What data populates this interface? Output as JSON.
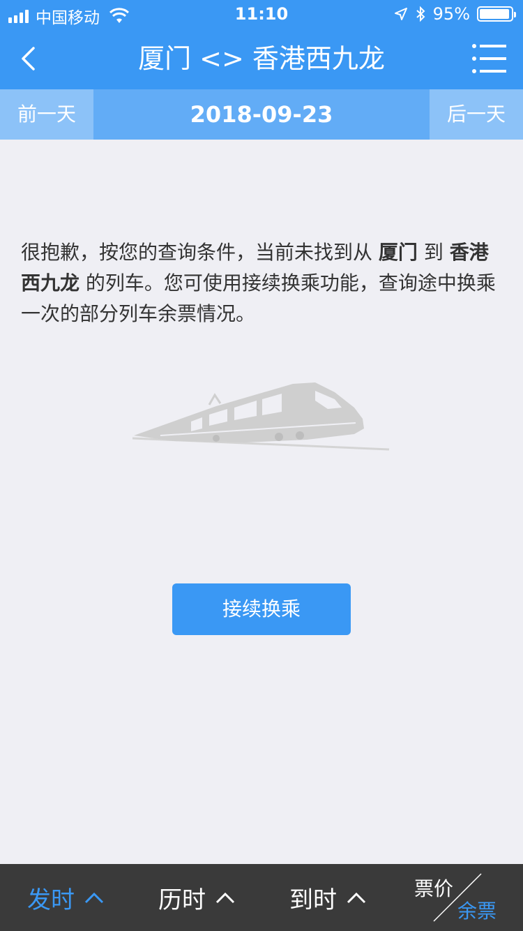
{
  "status_bar": {
    "carrier": "中国移动",
    "time": "11:10",
    "battery": "95%",
    "battery_level": 0.95,
    "icons": [
      "signal-icon",
      "wifi-icon",
      "location-icon",
      "bluetooth-icon",
      "battery-icon"
    ]
  },
  "nav": {
    "title": "厦门 <> 香港西九龙",
    "back_icon": "chevron-left-icon",
    "menu_icon": "list-menu-icon"
  },
  "date_bar": {
    "prev_label": "前一天",
    "current_date": "2018-09-23",
    "next_label": "后一天"
  },
  "message": {
    "part1": "很抱歉，按您的查询条件，当前未找到从 ",
    "from": "厦门",
    "part2": " 到 ",
    "to": "香港西九龙",
    "part3": " 的列车。您可使用接续换乘功能，查询途中换乘一次的部分列车余票情况。"
  },
  "illustration": "train-icon",
  "transfer_button": {
    "label": "接续换乘"
  },
  "sort_bar": {
    "depart": {
      "label": "发时",
      "active": true
    },
    "duration": {
      "label": "历时",
      "active": false
    },
    "arrive": {
      "label": "到时",
      "active": false
    },
    "price_top": "票价",
    "price_bottom": "余票"
  },
  "colors": {
    "primary": "#3a98f4",
    "date_bar": "#62acf6",
    "date_button": "#8cc2f8",
    "background": "#efeff4",
    "sort_bar": "#3a3a3a"
  }
}
